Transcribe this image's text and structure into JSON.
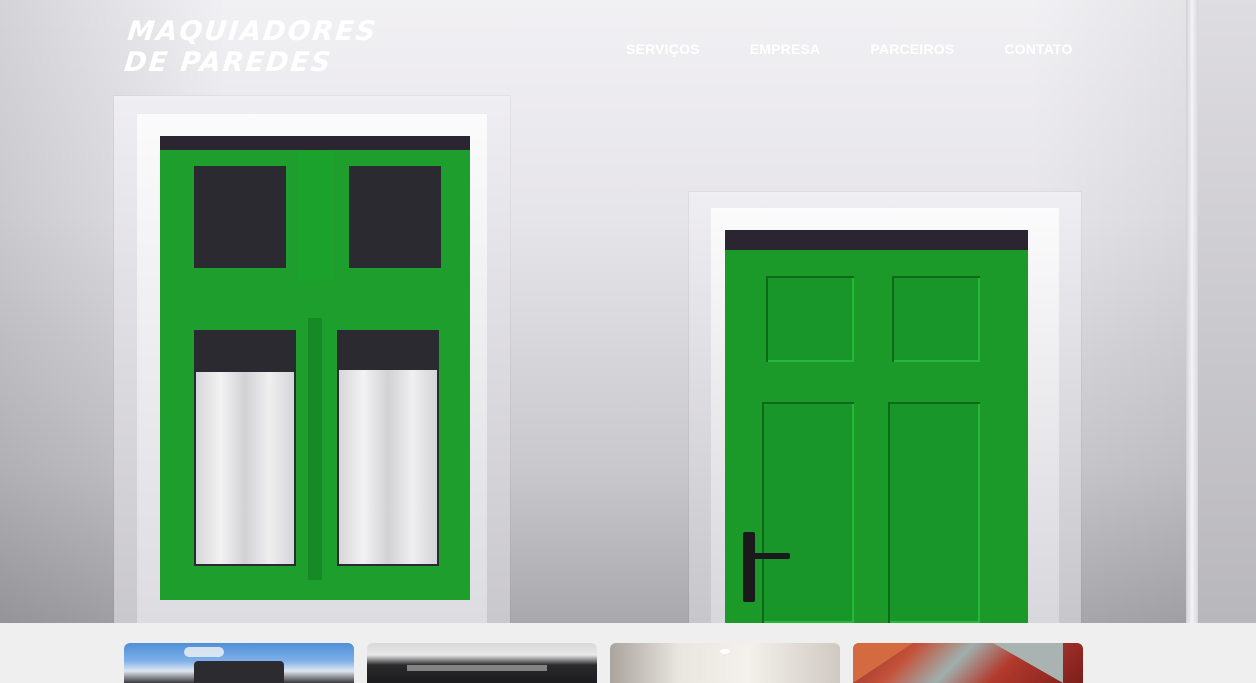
{
  "brand": {
    "logo_line1": "MAQUIADORES",
    "logo_line2": "DE PAREDES"
  },
  "nav": {
    "items": [
      {
        "label": "SERVIÇOS"
      },
      {
        "label": "EMPRESA"
      },
      {
        "label": "PARCEIROS"
      },
      {
        "label": "CONTATO"
      }
    ]
  },
  "colors": {
    "door_green": "#1d9b2a",
    "wall": "#e6e5ea",
    "nav_text": "#ffffff"
  },
  "cards": [
    {
      "name": "card-building"
    },
    {
      "name": "card-mural"
    },
    {
      "name": "card-interior"
    },
    {
      "name": "card-geometric"
    }
  ]
}
